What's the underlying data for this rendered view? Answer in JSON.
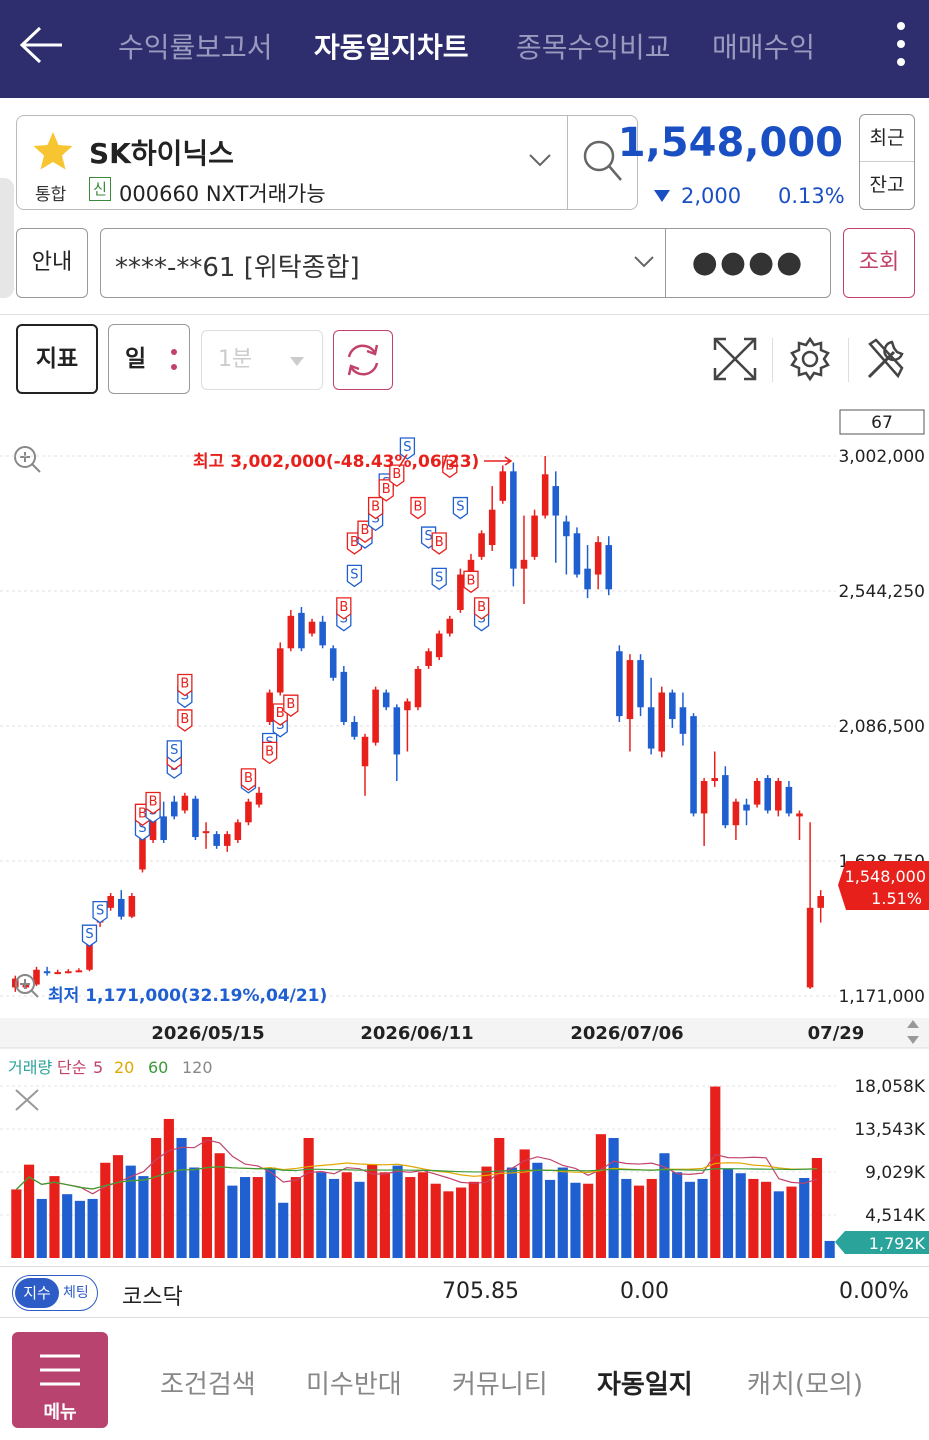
{
  "header": {
    "tabs": [
      {
        "label": "수익률보고서",
        "active": false
      },
      {
        "label": "자동일지차트",
        "active": true
      },
      {
        "label": "종목수익비교",
        "active": false
      },
      {
        "label": "매매수익",
        "active": false
      }
    ]
  },
  "stock": {
    "name": "SK하이닉스",
    "market": "통합",
    "credit_badge": "신",
    "code_info": "000660 NXT거래가능",
    "price": "1,548,000",
    "change": "2,000",
    "change_pct": "0.13%",
    "recent_label": "최근",
    "balance_label": "잔고"
  },
  "account": {
    "guide_label": "안내",
    "number": "****-**61 [위탁종합]",
    "password_mask": "●●●●",
    "query_label": "조회"
  },
  "toolbar": {
    "indicator_label": "지표",
    "period_label": "일",
    "minute_label": "1분"
  },
  "colors": {
    "up": "#e8201c",
    "down": "#1f5fd0",
    "accent": "#b8436e",
    "header": "#2e2e6e"
  },
  "chart_data": [
    {
      "type": "candlestick",
      "count_label": "67",
      "y_ticks": [
        "3,002,000",
        "2,544,250",
        "2,086,500",
        "1,628,750",
        "1,171,000"
      ],
      "ylim": [
        1171000,
        3002000
      ],
      "x_ticks": [
        "2026/05/15",
        "2026/06/11",
        "2026/07/06",
        "07/29"
      ],
      "high_annotation": "최고 3,002,000(-48.43%,06/23)",
      "low_annotation": "최저 1,171,000(32.19%,04/21)",
      "current_price_label": "1,548,000",
      "current_pct_label": "1.51%",
      "candles": [
        [
          1200000,
          1230000,
          1185000,
          1240000
        ],
        [
          1200000,
          1210000,
          1195000,
          1215000
        ],
        [
          1210000,
          1260000,
          1205000,
          1270000
        ],
        [
          1255000,
          1250000,
          1240000,
          1270000
        ],
        [
          1250000,
          1252000,
          1245000,
          1260000
        ],
        [
          1252000,
          1255000,
          1248000,
          1262000
        ],
        [
          1255000,
          1258000,
          1252000,
          1265000
        ],
        [
          1260000,
          1370000,
          1255000,
          1375000
        ],
        [
          1420000,
          1460000,
          1405000,
          1470000
        ],
        [
          1470000,
          1510000,
          1460000,
          1520000
        ],
        [
          1500000,
          1440000,
          1430000,
          1530000
        ],
        [
          1440000,
          1510000,
          1435000,
          1520000
        ],
        [
          1600000,
          1710000,
          1590000,
          1730000
        ],
        [
          1700000,
          1780000,
          1690000,
          1790000
        ],
        [
          1780000,
          1700000,
          1690000,
          1830000
        ],
        [
          1830000,
          1780000,
          1770000,
          1850000
        ],
        [
          1800000,
          1850000,
          1790000,
          1860000
        ],
        [
          1840000,
          1710000,
          1700000,
          1850000
        ],
        [
          1730000,
          1730000,
          1670000,
          1760000
        ],
        [
          1720000,
          1680000,
          1670000,
          1730000
        ],
        [
          1680000,
          1720000,
          1660000,
          1730000
        ],
        [
          1700000,
          1760000,
          1690000,
          1770000
        ],
        [
          1760000,
          1830000,
          1750000,
          1840000
        ],
        [
          1820000,
          1860000,
          1810000,
          1880000
        ],
        [
          2100000,
          2200000,
          2090000,
          2210000
        ],
        [
          2200000,
          2350000,
          2190000,
          2370000
        ],
        [
          2350000,
          2460000,
          2340000,
          2480000
        ],
        [
          2470000,
          2350000,
          2340000,
          2490000
        ],
        [
          2400000,
          2440000,
          2390000,
          2450000
        ],
        [
          2440000,
          2360000,
          2350000,
          2460000
        ],
        [
          2350000,
          2250000,
          2240000,
          2360000
        ],
        [
          2270000,
          2100000,
          2090000,
          2290000
        ],
        [
          2100000,
          2050000,
          2040000,
          2120000
        ],
        [
          1950000,
          2050000,
          1850000,
          2060000
        ],
        [
          2030000,
          2210000,
          2020000,
          2220000
        ],
        [
          2200000,
          2150000,
          2140000,
          2210000
        ],
        [
          2150000,
          1990000,
          1900000,
          2160000
        ],
        [
          2140000,
          2170000,
          2000000,
          2180000
        ],
        [
          2150000,
          2280000,
          2140000,
          2290000
        ],
        [
          2290000,
          2340000,
          2280000,
          2350000
        ],
        [
          2320000,
          2400000,
          2310000,
          2410000
        ],
        [
          2400000,
          2450000,
          2390000,
          2460000
        ],
        [
          2480000,
          2600000,
          2470000,
          2620000
        ],
        [
          2600000,
          2650000,
          2590000,
          2670000
        ],
        [
          2660000,
          2740000,
          2650000,
          2750000
        ],
        [
          2700000,
          2820000,
          2680000,
          2900000
        ],
        [
          2850000,
          2950000,
          2840000,
          2970000
        ],
        [
          2950000,
          2620000,
          2560000,
          2980000
        ],
        [
          2620000,
          2650000,
          2500000,
          2800000
        ],
        [
          2660000,
          2800000,
          2650000,
          2820000
        ],
        [
          2800000,
          2940000,
          2790000,
          3002000
        ],
        [
          2900000,
          2800000,
          2640000,
          2950000
        ],
        [
          2780000,
          2730000,
          2600000,
          2800000
        ],
        [
          2740000,
          2600000,
          2590000,
          2760000
        ],
        [
          2620000,
          2550000,
          2520000,
          2700000
        ],
        [
          2600000,
          2710000,
          2550000,
          2730000
        ],
        [
          2700000,
          2550000,
          2530000,
          2730000
        ],
        [
          2340000,
          2120000,
          2100000,
          2360000
        ],
        [
          2110000,
          2310000,
          2000000,
          2330000
        ],
        [
          2310000,
          2150000,
          2120000,
          2330000
        ],
        [
          2150000,
          2010000,
          1990000,
          2250000
        ],
        [
          2000000,
          2200000,
          1980000,
          2220000
        ],
        [
          2200000,
          2110000,
          2080000,
          2210000
        ],
        [
          2150000,
          2060000,
          2020000,
          2200000
        ],
        [
          2120000,
          1790000,
          1780000,
          2130000
        ],
        [
          1790000,
          1900000,
          1680000,
          1910000
        ],
        [
          1900000,
          1910000,
          1880000,
          2000000
        ],
        [
          1920000,
          1750000,
          1740000,
          1950000
        ],
        [
          1750000,
          1830000,
          1700000,
          1840000
        ],
        [
          1820000,
          1800000,
          1750000,
          1840000
        ],
        [
          1820000,
          1900000,
          1810000,
          1910000
        ],
        [
          1910000,
          1800000,
          1790000,
          1920000
        ],
        [
          1800000,
          1900000,
          1780000,
          1910000
        ],
        [
          1880000,
          1790000,
          1780000,
          1900000
        ],
        [
          1780000,
          1790000,
          1700000,
          1800000
        ],
        [
          1200000,
          1470000,
          1195000,
          1760000
        ],
        [
          1470000,
          1510000,
          1420000,
          1530000
        ]
      ],
      "signals": [
        [
          7,
          "S",
          1350000
        ],
        [
          8,
          "S",
          1430000
        ],
        [
          12,
          "S",
          1710000
        ],
        [
          12,
          "B",
          1760000
        ],
        [
          13,
          "S",
          1770000
        ],
        [
          13,
          "B",
          1800000
        ],
        [
          15,
          "S",
          1920000
        ],
        [
          15,
          "B",
          1950000
        ],
        [
          15,
          "S",
          1975000
        ],
        [
          16,
          "B",
          2080000
        ],
        [
          16,
          "S",
          2160000
        ],
        [
          16,
          "B",
          2200000
        ],
        [
          22,
          "S",
          1870000
        ],
        [
          22,
          "B",
          1880000
        ],
        [
          24,
          "S",
          2000000
        ],
        [
          24,
          "B",
          1970000
        ],
        [
          25,
          "S",
          2060000
        ],
        [
          25,
          "B",
          2100000
        ],
        [
          26,
          "B",
          2130000
        ],
        [
          31,
          "S",
          2420000
        ],
        [
          31,
          "B",
          2460000
        ],
        [
          32,
          "S",
          2570000
        ],
        [
          32,
          "B",
          2680000
        ],
        [
          33,
          "S",
          2700000
        ],
        [
          33,
          "B",
          2720000
        ],
        [
          34,
          "S",
          2760000
        ],
        [
          34,
          "B",
          2800000
        ],
        [
          35,
          "S",
          2880000
        ],
        [
          35,
          "B",
          2860000
        ],
        [
          36,
          "B",
          2910000
        ],
        [
          37,
          "S",
          3002000
        ],
        [
          38,
          "B",
          2800000
        ],
        [
          39,
          "S",
          2700000
        ],
        [
          40,
          "S",
          2560000
        ],
        [
          40,
          "B",
          2680000
        ],
        [
          41,
          "B",
          2940000
        ],
        [
          42,
          "S",
          2800000
        ],
        [
          43,
          "B",
          2550000
        ],
        [
          44,
          "S",
          2420000
        ],
        [
          44,
          "B",
          2460000
        ]
      ]
    },
    {
      "type": "bar",
      "title": "거래량 단순 5 20 60 120",
      "legend": [
        "거래량",
        "단순",
        "5",
        "20",
        "60",
        "120"
      ],
      "y_ticks": [
        "18,058K",
        "13,543K",
        "9,029K",
        "4,514K"
      ],
      "ylim": [
        0,
        18058
      ],
      "current_volume_label": "1,792K",
      "values": [
        7200,
        9800,
        6200,
        8600,
        6700,
        6000,
        6200,
        10000,
        10800,
        9700,
        8600,
        12600,
        14600,
        12600,
        9500,
        12700,
        11000,
        7600,
        8500,
        8500,
        9500,
        5800,
        8500,
        12600,
        9000,
        8300,
        9000,
        8000,
        9800,
        9000,
        9700,
        8500,
        9000,
        7800,
        7000,
        7400,
        8000,
        9600,
        12600,
        9500,
        11400,
        10000,
        8200,
        9500,
        7900,
        7800,
        13000,
        12600,
        8300,
        7600,
        8300,
        11000,
        9000,
        8000,
        8300,
        18000,
        9400,
        8900,
        8300,
        8000,
        7000,
        7500,
        8400,
        10500,
        1792
      ],
      "up_flags": [
        1,
        1,
        0,
        1,
        0,
        0,
        0,
        1,
        1,
        0,
        0,
        1,
        1,
        0,
        0,
        1,
        1,
        0,
        0,
        1,
        0,
        0,
        1,
        1,
        0,
        0,
        1,
        0,
        1,
        1,
        0,
        1,
        1,
        1,
        1,
        1,
        1,
        1,
        1,
        0,
        1,
        0,
        0,
        0,
        0,
        1,
        1,
        0,
        0,
        1,
        1,
        0,
        0,
        0,
        0,
        1,
        0,
        0,
        1,
        1,
        0,
        1,
        0,
        1,
        0
      ]
    }
  ],
  "market_index": {
    "toggle_on": "지수",
    "toggle_off": "체팅",
    "name": "코스닥",
    "value": "705.85",
    "change": "0.00",
    "change_pct": "0.00%"
  },
  "bottom_nav": {
    "menu_label": "메뉴",
    "items": [
      {
        "label": "조건검색",
        "active": false
      },
      {
        "label": "미수반대",
        "active": false
      },
      {
        "label": "커뮤니티",
        "active": false
      },
      {
        "label": "자동일지",
        "active": true
      },
      {
        "label": "캐치(모의)",
        "active": false
      }
    ]
  }
}
